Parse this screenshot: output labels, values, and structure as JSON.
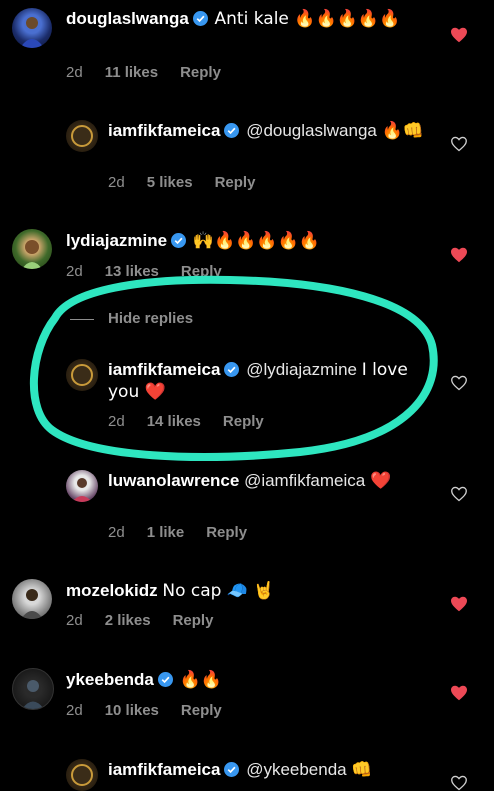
{
  "comments": [
    {
      "username": "douglaslwanga",
      "verified": true,
      "text": "Anti kale 🔥🔥🔥🔥🔥",
      "time": "2d",
      "likes": "11 likes",
      "reply": "Reply",
      "liked": true
    },
    {
      "username": "iamfikfameica",
      "verified": true,
      "mention": "@douglaslwanga",
      "text": "🔥👊",
      "time": "2d",
      "likes": "5 likes",
      "reply": "Reply",
      "liked": false
    },
    {
      "username": "lydiajazmine",
      "verified": true,
      "text": "🙌🔥🔥🔥🔥🔥",
      "time": "2d",
      "likes": "13 likes",
      "reply": "Reply",
      "liked": true
    },
    {
      "username": "iamfikfameica",
      "verified": true,
      "mention": "@lydiajazmine",
      "text": "I love you ❤️",
      "time": "2d",
      "likes": "14 likes",
      "reply": "Reply",
      "liked": false
    },
    {
      "username": "luwanolawrence",
      "verified": false,
      "mention": "@iamfikfameica",
      "text": "❤️",
      "time": "2d",
      "likes": "1 like",
      "reply": "Reply",
      "liked": false
    },
    {
      "username": "mozelokidz",
      "verified": false,
      "text": "No cap 🧢 🤘",
      "time": "2d",
      "likes": "2 likes",
      "reply": "Reply",
      "liked": true
    },
    {
      "username": "ykeebenda",
      "verified": true,
      "text": "🔥🔥",
      "time": "2d",
      "likes": "10 likes",
      "reply": "Reply",
      "liked": true
    },
    {
      "username": "iamfikfameica",
      "verified": true,
      "mention": "@ykeebenda",
      "text": "👊",
      "liked": false
    }
  ],
  "hide_replies": "Hide replies",
  "colors": {
    "background": "#000000",
    "heart_liked": "#ed4956",
    "meta_text": "#8e8e8e",
    "verified_badge": "#3897f0",
    "highlight_circle": "#2ee6c0"
  }
}
